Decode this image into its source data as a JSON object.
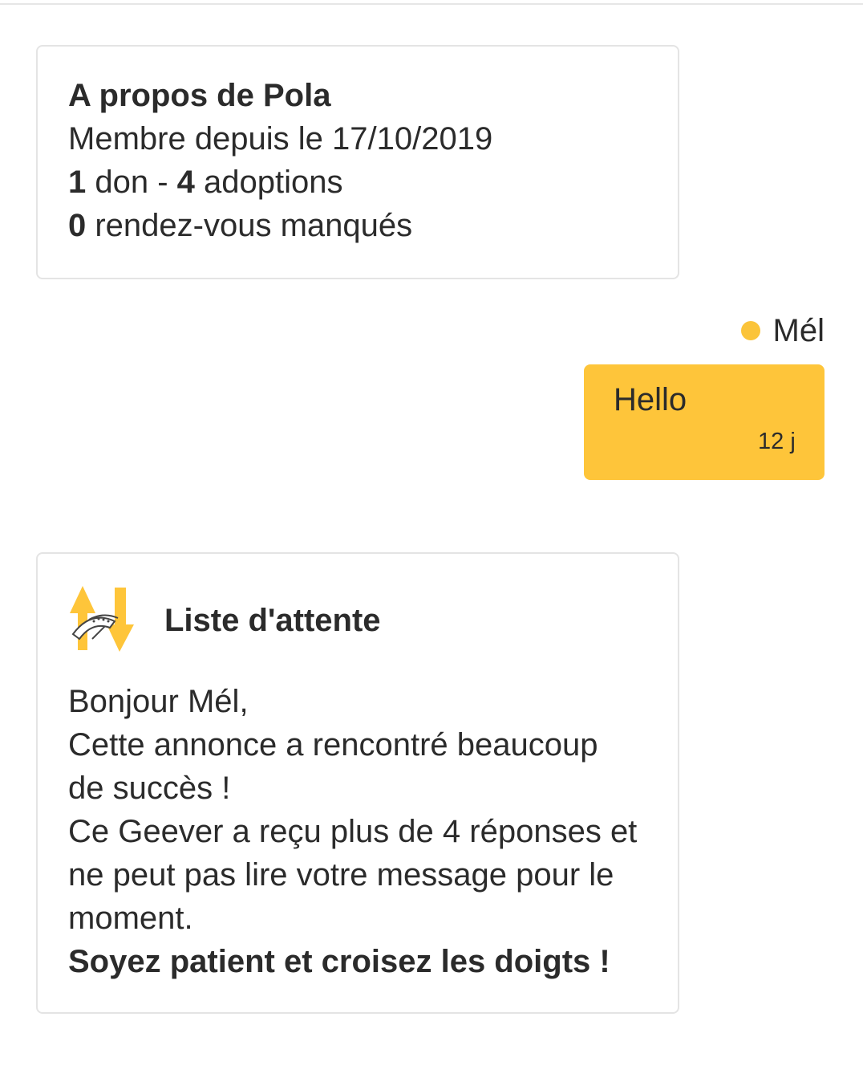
{
  "about": {
    "title": "A propos de Pola",
    "member_since": "Membre depuis le 17/10/2019",
    "dons_count": "1",
    "dons_label": " don - ",
    "adoptions_count": "4",
    "adoptions_label": " adoptions",
    "missed_count": "0",
    "missed_label": " rendez-vous manqués"
  },
  "message": {
    "sender": "Mél",
    "text": "Hello",
    "time": "12 j"
  },
  "waitlist": {
    "title": "Liste d'attente",
    "icon": "waitlist-arrows-icon",
    "lines": [
      "Bonjour Mél,",
      "Cette annonce a rencontré beaucoup",
      "de succès !",
      "Ce Geever a reçu plus de 4 réponses et",
      "ne peut pas lire votre message pour le",
      "moment."
    ],
    "closing": "Soyez patient et croisez les doigts !"
  },
  "colors": {
    "accent": "#fec53a",
    "dot": "#fbc43a",
    "border": "#e4e4e4",
    "text": "#2b2b2b"
  }
}
